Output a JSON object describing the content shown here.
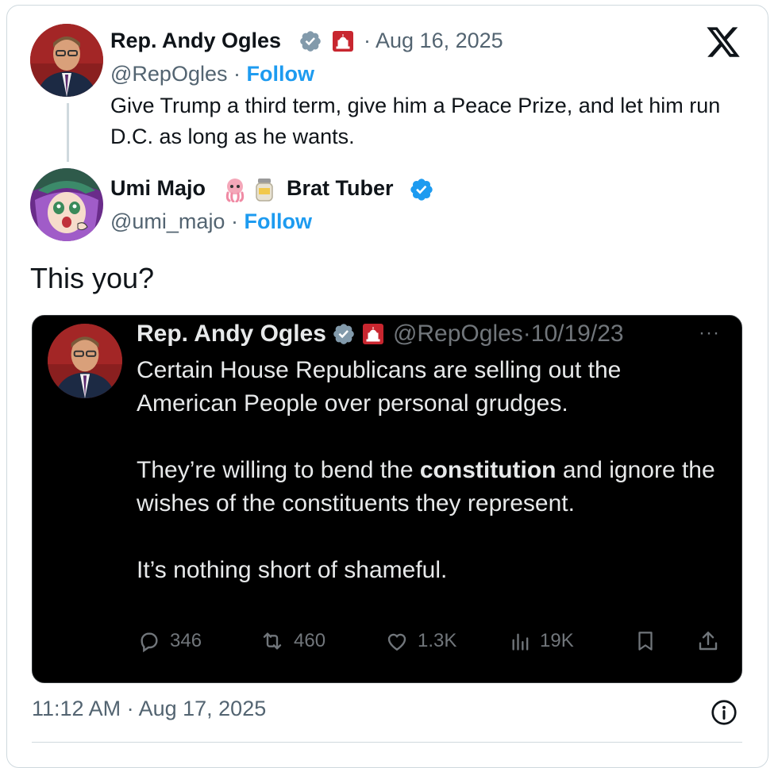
{
  "brand": {
    "logo_icon": "x-logo-icon",
    "accent": "#1d9bf0"
  },
  "reply_context_tweet": {
    "author_name": "Rep. Andy Ogles",
    "handle": "@RepOgles",
    "separator": "·",
    "date": "Aug 16, 2025",
    "follow_label": "Follow",
    "text": "Give Trump a third term, give him a Peace Prize, and let him run D.C. as long as he wants."
  },
  "main_tweet": {
    "author_name_part1": "Umi Majo",
    "author_name_part2": "Brat Tuber",
    "emojis": [
      "octopus-emoji",
      "jar-emoji"
    ],
    "handle": "@umi_majo",
    "separator": "·",
    "follow_label": "Follow",
    "text": "This you?",
    "timestamp": "11:12 AM · Aug 17, 2025",
    "info_icon": "info-icon"
  },
  "quoted_tweet": {
    "author_name": "Rep. Andy Ogles",
    "handle": "@RepOgles",
    "separator": "·",
    "date": "10/19/23",
    "more_label": "···",
    "para1": "Certain House Republicans are selling out the American People over personal grudges.",
    "para2_before": "They’re willing to bend the ",
    "para2_bold": "constitution",
    "para2_after": " and ignore the wishes of the constituents they represent.",
    "para3": "It’s nothing short of shameful.",
    "stats": {
      "replies": "346",
      "reposts": "460",
      "likes": "1.3K",
      "views": "19K"
    }
  }
}
